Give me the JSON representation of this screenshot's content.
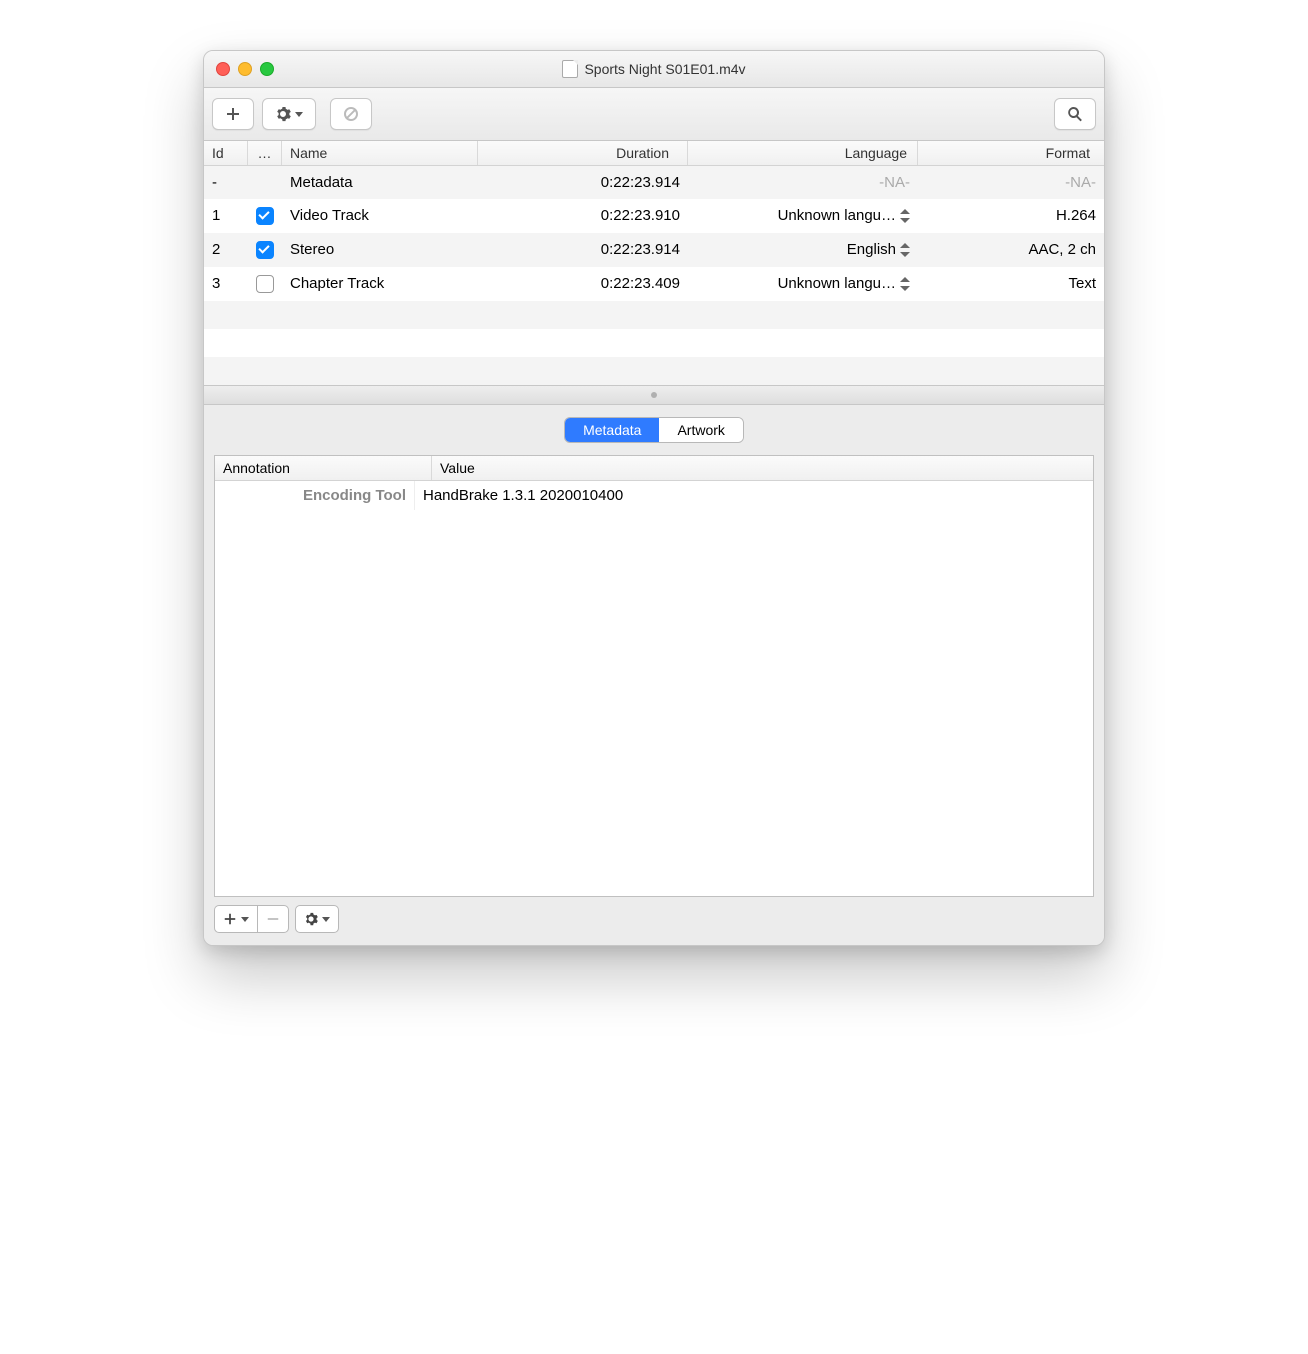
{
  "window": {
    "title": "Sports Night S01E01.m4v"
  },
  "tracks": {
    "columns": {
      "id": "Id",
      "enabled": "…",
      "name": "Name",
      "duration": "Duration",
      "language": "Language",
      "format": "Format"
    },
    "rows": [
      {
        "id": "-",
        "enabled": null,
        "name": "Metadata",
        "duration": "0:22:23.914",
        "language": "-NA-",
        "lang_popup": false,
        "format": "-NA-",
        "na": true
      },
      {
        "id": "1",
        "enabled": true,
        "name": "Video Track",
        "duration": "0:22:23.910",
        "language": "Unknown langu…",
        "lang_popup": true,
        "format": "H.264"
      },
      {
        "id": "2",
        "enabled": true,
        "name": "Stereo",
        "duration": "0:22:23.914",
        "language": "English",
        "lang_popup": true,
        "format": "AAC, 2 ch"
      },
      {
        "id": "3",
        "enabled": false,
        "name": "Chapter Track",
        "duration": "0:22:23.409",
        "language": "Unknown langu…",
        "lang_popup": true,
        "format": "Text"
      }
    ]
  },
  "detail": {
    "tabs": [
      "Metadata",
      "Artwork"
    ],
    "active_tab": 0,
    "columns": {
      "annotation": "Annotation",
      "value": "Value"
    },
    "rows": [
      {
        "annotation": "Encoding Tool",
        "value": "HandBrake 1.3.1 2020010400"
      }
    ]
  }
}
